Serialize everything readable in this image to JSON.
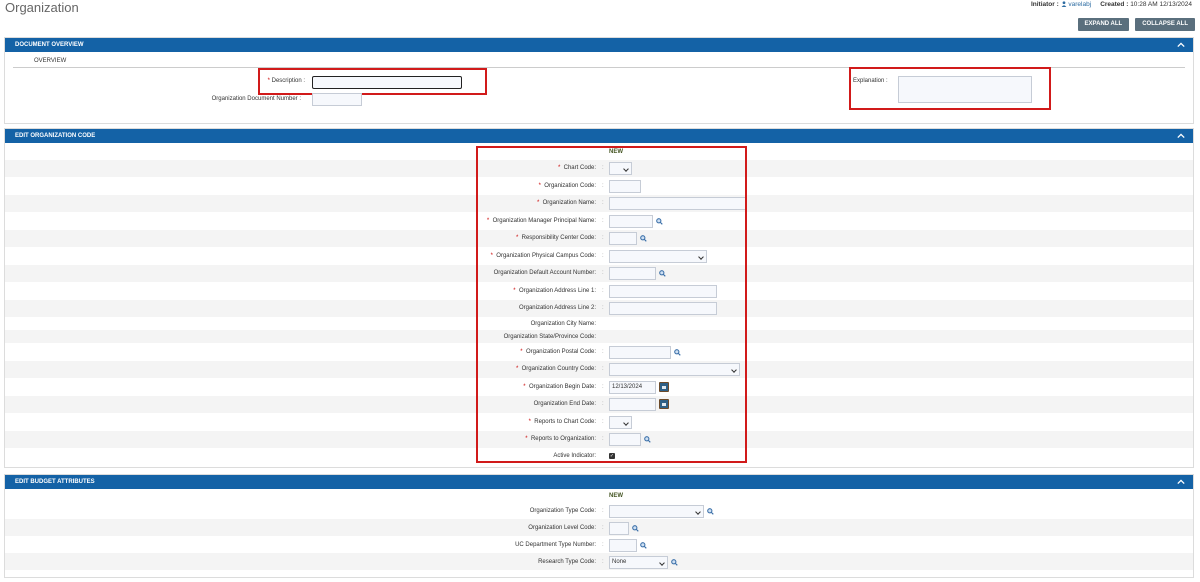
{
  "page": {
    "title": "Organization"
  },
  "topinfo": {
    "initiator_label": "Initiator :",
    "initiator_user": "varelabj",
    "created_label": "Created :",
    "created_value": "10:28 AM 12/13/2024"
  },
  "buttons": {
    "expand_all": "EXPAND ALL",
    "collapse_all": "COLLAPSE ALL"
  },
  "overview": {
    "header": "DOCUMENT OVERVIEW",
    "tab": "OVERVIEW",
    "description_label": "Description :",
    "description_value": "",
    "org_doc_number_label": "Organization Document Number :",
    "explanation_label": "Explanation :"
  },
  "edit_org": {
    "header": "EDIT ORGANIZATION CODE",
    "new_label": "NEW",
    "fields": [
      {
        "label": "Chart Code:",
        "required": true,
        "value": ""
      },
      {
        "label": "Organization Code:",
        "required": true,
        "value": ""
      },
      {
        "label": "Organization Name:",
        "required": true,
        "value": ""
      },
      {
        "label": "Organization Manager Principal Name:",
        "required": true,
        "value": ""
      },
      {
        "label": "Responsibility Center Code:",
        "required": true,
        "value": ""
      },
      {
        "label": "Organization Physical Campus Code:",
        "required": true,
        "value": ""
      },
      {
        "label": "Organization Default Account Number:",
        "required": false,
        "value": ""
      },
      {
        "label": "Organization Address Line 1:",
        "required": true,
        "value": ""
      },
      {
        "label": "Organization Address Line 2:",
        "required": false,
        "value": ""
      },
      {
        "label": "Organization City Name:",
        "required": false,
        "value": ""
      },
      {
        "label": "Organization State/Province Code:",
        "required": false,
        "value": ""
      },
      {
        "label": "Organization Postal Code:",
        "required": true,
        "value": ""
      },
      {
        "label": "Organization Country Code:",
        "required": true,
        "value": ""
      },
      {
        "label": "Organization Begin Date:",
        "required": true,
        "value": "12/13/2024"
      },
      {
        "label": "Organization End Date:",
        "required": false,
        "value": ""
      },
      {
        "label": "Reports to Chart Code:",
        "required": true,
        "value": ""
      },
      {
        "label": "Reports to Organization:",
        "required": true,
        "value": ""
      },
      {
        "label": "Active Indicator:",
        "required": false,
        "value": ""
      }
    ]
  },
  "budget": {
    "header": "EDIT BUDGET ATTRIBUTES",
    "new_label": "NEW",
    "fields": [
      {
        "label": "Organization Type Code:",
        "value": ""
      },
      {
        "label": "Organization Level Code:",
        "value": ""
      },
      {
        "label": "UC Department Type Number:",
        "value": ""
      },
      {
        "label": "Research Type Code:",
        "value": "None"
      }
    ]
  },
  "colors": {
    "header_blue": "#1462a6",
    "highlight_red": "#d11a1a",
    "button_gray": "#5a6f7d"
  }
}
